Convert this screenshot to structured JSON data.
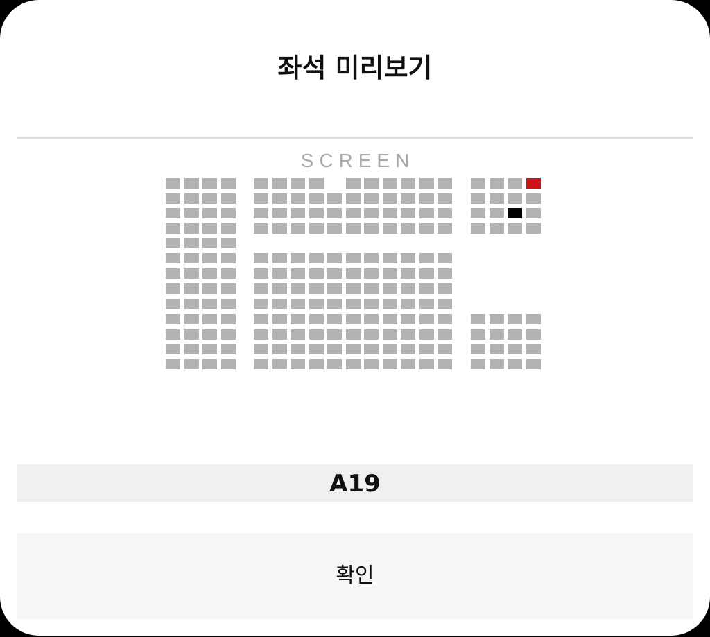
{
  "dialog": {
    "title": "좌석 미리보기",
    "screen_label": "SCREEN",
    "selected_seat": "A19",
    "confirm_label": "확인"
  },
  "seat_map": {
    "rows": 13,
    "blocks": {
      "left": {
        "columns": 4,
        "rows": [
          1,
          2,
          3,
          4,
          5,
          6,
          7,
          8,
          9,
          10,
          11,
          12,
          13
        ]
      },
      "center": {
        "columns": 11,
        "rows": [
          1,
          2,
          3,
          4,
          6,
          7,
          8,
          9,
          10,
          11,
          12,
          13
        ],
        "missing": [
          [
            1,
            5
          ]
        ]
      },
      "right": {
        "columns": 4,
        "rows": [
          1,
          2,
          3,
          4,
          10,
          11,
          12,
          13
        ]
      }
    },
    "seat_states": {
      "booked": [
        {
          "block": "right",
          "row": 1,
          "col": 4
        }
      ],
      "selected": [
        {
          "block": "right",
          "row": 3,
          "col": 3
        }
      ]
    },
    "colors": {
      "available": "#b3b3b3",
      "booked": "#cc1418",
      "selected": "#000000"
    }
  }
}
